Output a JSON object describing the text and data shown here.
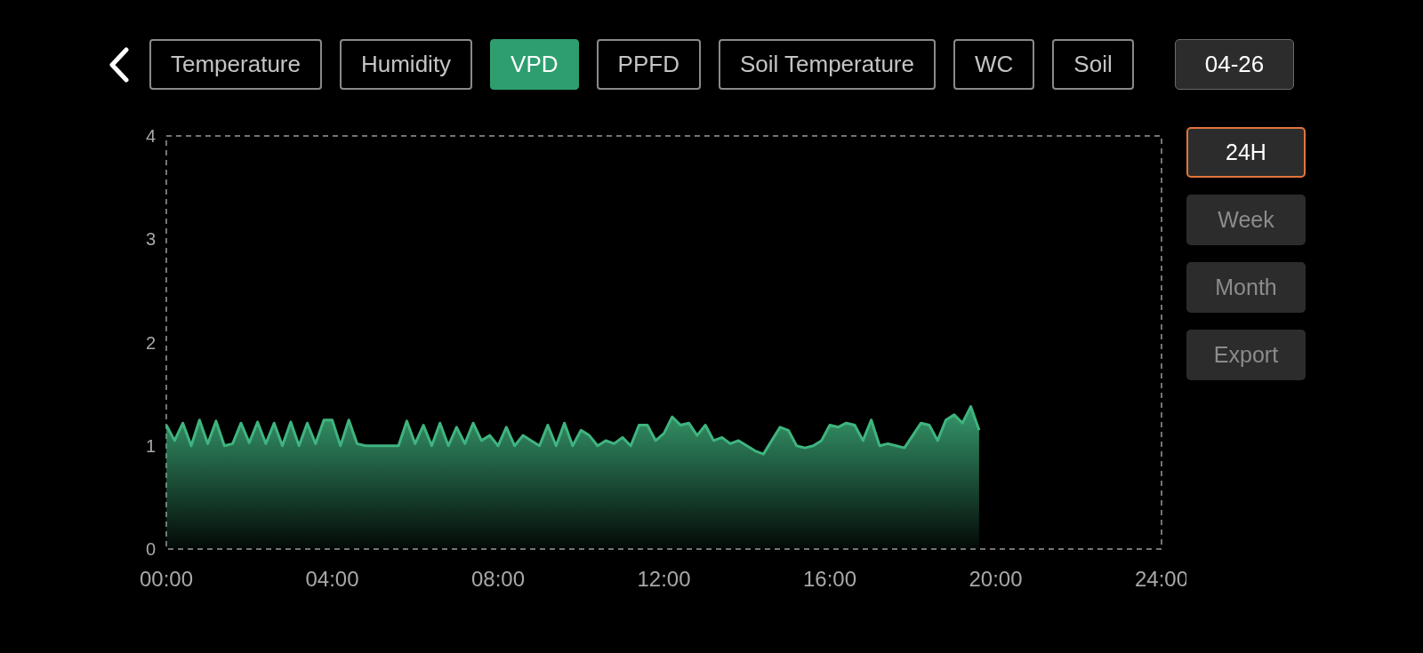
{
  "tabs": [
    {
      "label": "Temperature",
      "selected": false
    },
    {
      "label": "Humidity",
      "selected": false
    },
    {
      "label": "VPD",
      "selected": true
    },
    {
      "label": "PPFD",
      "selected": false
    },
    {
      "label": "Soil Temperature",
      "selected": false
    },
    {
      "label": "WC",
      "selected": false
    },
    {
      "label": "Soil",
      "selected": false
    }
  ],
  "date": "04-26",
  "ranges": [
    {
      "label": "24H",
      "selected": true
    },
    {
      "label": "Week",
      "selected": false
    },
    {
      "label": "Month",
      "selected": false
    }
  ],
  "export_button": "Export",
  "chart_data": {
    "type": "area",
    "xlim": [
      0,
      24
    ],
    "ylim": [
      0,
      4
    ],
    "yticks": [
      0,
      1,
      2,
      3,
      4
    ],
    "xticks": [
      {
        "value": 0,
        "label": "00:00"
      },
      {
        "value": 4,
        "label": "04:00"
      },
      {
        "value": 8,
        "label": "08:00"
      },
      {
        "value": 12,
        "label": "12:00"
      },
      {
        "value": 16,
        "label": "16:00"
      },
      {
        "value": 20,
        "label": "20:00"
      },
      {
        "value": 24,
        "label": "24:00"
      }
    ],
    "x": [
      0,
      0.2,
      0.4,
      0.6,
      0.8,
      1,
      1.2,
      1.4,
      1.6,
      1.8,
      2,
      2.2,
      2.4,
      2.6,
      2.8,
      3,
      3.2,
      3.4,
      3.6,
      3.8,
      4,
      4.2,
      4.4,
      4.6,
      4.8,
      5,
      5.2,
      5.4,
      5.6,
      5.8,
      6,
      6.2,
      6.4,
      6.6,
      6.8,
      7,
      7.2,
      7.4,
      7.6,
      7.8,
      8,
      8.2,
      8.4,
      8.6,
      8.8,
      9,
      9.2,
      9.4,
      9.6,
      9.8,
      10,
      10.2,
      10.4,
      10.6,
      10.8,
      11,
      11.2,
      11.4,
      11.6,
      11.8,
      12,
      12.2,
      12.4,
      12.6,
      12.8,
      13,
      13.2,
      13.4,
      13.6,
      13.8,
      14,
      14.2,
      14.4,
      14.6,
      14.8,
      15,
      15.2,
      15.4,
      15.6,
      15.8,
      16,
      16.2,
      16.4,
      16.6,
      16.8,
      17,
      17.2,
      17.4,
      17.6,
      17.8,
      18,
      18.2,
      18.4,
      18.6,
      18.8,
      19,
      19.2,
      19.4,
      19.6
    ],
    "series": [
      {
        "color": "#3fb47f",
        "values": [
          1.2,
          1.05,
          1.22,
          1.0,
          1.25,
          1.02,
          1.24,
          1.0,
          1.02,
          1.22,
          1.03,
          1.23,
          1.02,
          1.22,
          1.0,
          1.23,
          1.0,
          1.22,
          1.02,
          1.25,
          1.25,
          1.0,
          1.25,
          1.02,
          1.0,
          1.0,
          1.0,
          1.0,
          1.0,
          1.24,
          1.02,
          1.2,
          1.0,
          1.22,
          1.0,
          1.18,
          1.02,
          1.22,
          1.05,
          1.1,
          1.0,
          1.18,
          1.0,
          1.1,
          1.05,
          1.0,
          1.2,
          1.0,
          1.22,
          1.0,
          1.15,
          1.1,
          1.0,
          1.05,
          1.02,
          1.08,
          1.0,
          1.2,
          1.2,
          1.05,
          1.12,
          1.28,
          1.2,
          1.22,
          1.1,
          1.2,
          1.05,
          1.08,
          1.02,
          1.05,
          1.0,
          0.95,
          0.92,
          1.05,
          1.18,
          1.15,
          1.0,
          0.98,
          1.0,
          1.05,
          1.2,
          1.18,
          1.22,
          1.2,
          1.05,
          1.25,
          1.0,
          1.02,
          1.0,
          0.98,
          1.1,
          1.22,
          1.2,
          1.05,
          1.25,
          1.3,
          1.22,
          1.38,
          1.15
        ]
      }
    ]
  }
}
